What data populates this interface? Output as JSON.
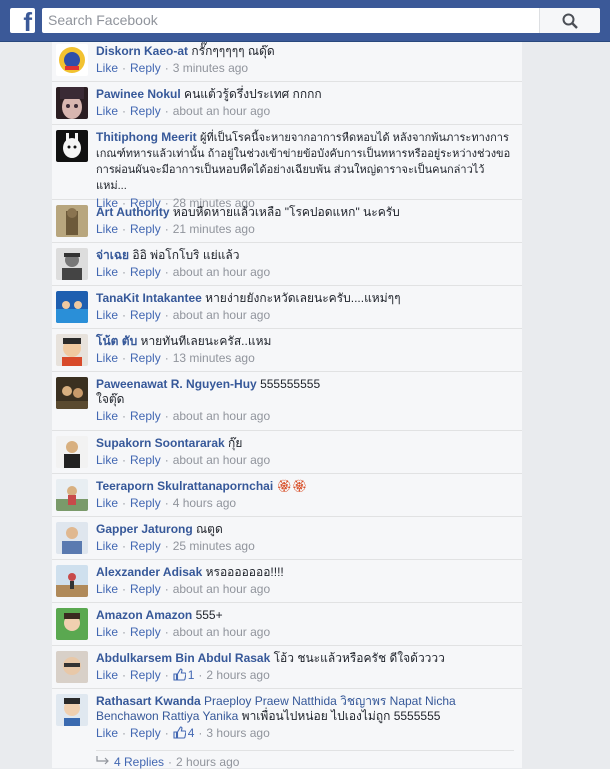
{
  "header": {
    "logo": "f",
    "search_placeholder": "Search Facebook"
  },
  "actions": {
    "like": "Like",
    "reply": "Reply",
    "sep": "·"
  },
  "comments": [
    {
      "name": "Diskorn Kaeo-at",
      "text": "กรั๊กๆๆๆๆๆ ณดุ๊ด",
      "time": "3 minutes ago",
      "likes": ""
    },
    {
      "name": "Pawinee Nokul",
      "text": "คนแต้วรู้ดรึ่งประเทศ กกกก",
      "time": "about an hour ago",
      "likes": ""
    },
    {
      "name": "Thitiphong Meerit",
      "text": "ผู้ที่เป็นโรคนี้จะหายจากอาการหืดหอบได้ หลังจากพ้นภาระทางการเกณฑ์ทหารแล้วเท่านั้น ถ้าอยู่ในช่วงเข้าข่ายข้อบังคับการเป็นทหารหรืออยู่ระหว่างช่วงขอการผ่อนผันจะมีอาการเป็นหอบหืดได้อย่างเฉียบพ้น ส่วนใหญ่ดาราจะเป็นคนกล่าวไว้ แหม่...",
      "time": "28 minutes ago",
      "likes": ""
    },
    {
      "name": "Art Authority",
      "text": "หอบหืดหายแล้วเหลือ \"โรคปอดแหก\" นะครับ",
      "time": "21 minutes ago",
      "likes": ""
    },
    {
      "name": "จ่าเฉย",
      "text": "อิอิ พ่อโกโบริ แย่แล้ว",
      "time": "about an hour ago",
      "likes": ""
    },
    {
      "name": "TanaKit Intakantee",
      "text": "หายง่ายยังกะหวัดเลยนะครับ....แหม่ๆๆ",
      "time": "about an hour ago",
      "likes": ""
    },
    {
      "name": "โน้ต ตับ",
      "text": "หายทันทีเลยนะครัส..แหม",
      "time": "13 minutes ago",
      "likes": ""
    },
    {
      "name": "Paweenawat R. Nguyen-Huy",
      "text": "555555555\nใจตุ๊ด",
      "time": "about an hour ago",
      "likes": ""
    },
    {
      "name": "Supakorn Soontararak",
      "text": "กุ๊ย",
      "time": "about an hour ago",
      "likes": ""
    },
    {
      "name": "Teeraporn Skulrattanapornchai",
      "text": "🏵🏵",
      "time": "4 hours ago",
      "likes": ""
    },
    {
      "name": "Gapper Jaturong",
      "text": "ณตูด",
      "time": "25 minutes ago",
      "likes": ""
    },
    {
      "name": "Alexzander Adisak",
      "text": "หรอออออออ!!!!",
      "time": "about an hour ago",
      "likes": ""
    },
    {
      "name": "Amazon Amazon",
      "text": "555+",
      "time": "about an hour ago",
      "likes": ""
    },
    {
      "name": "Abdulkarsem Bin Abdul Rasak",
      "text": "โอ้ว ชนะแล้วหรือครัช ดีใจด้วววว",
      "time": "2 hours ago",
      "likes": "1"
    },
    {
      "name": "Rathasart Kwanda",
      "tags": "Praeploy Praew Natthida วิชญาพร Napat Nicha Benchawon Rattiya Yanika",
      "text": "พาเพื่อนไปหน่อย ไปเองไม่ถูก 5555555",
      "time": "3 hours ago",
      "likes": "4"
    }
  ],
  "replies_link": {
    "label": "4 Replies",
    "time": "2 hours ago"
  },
  "colors": {
    "brand": "#3b5998",
    "link": "#365899",
    "action": "#4267b2",
    "muted": "#90949c"
  }
}
